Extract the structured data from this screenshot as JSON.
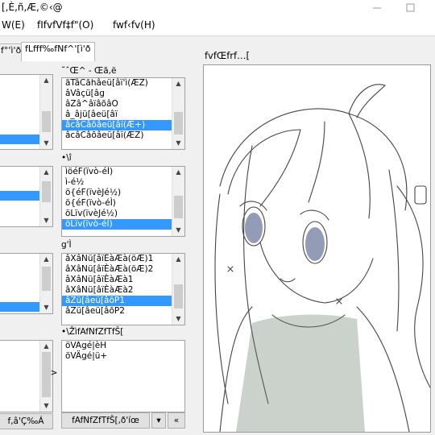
{
  "window": {
    "title": "[,È,ñ,Æ,©‹@"
  },
  "menu": {
    "items": [
      "W(E)",
      "fIfvfVf‡f\"(O)",
      "fwf‹fv(H)"
    ]
  },
  "tabs": [
    "f°'ì'ð",
    "fLfff‰fNf^'[ì'ð"
  ],
  "groups": {
    "g1_label": "˜ˆŒ^ - Œã,ë",
    "g2_label": "•\\î",
    "g3_label": "g'Ì",
    "g4_label": "•\\ŽìfAfNfZfTfŠ["
  },
  "list1": [
    "ãTâCãhâeü[âï'ì(ÆZ)",
    "âVâçü[âg",
    "âZâ^âïâõâO",
    "â_âjü[âeü[âï",
    "âcâCâõâeü[âï(Æ+)",
    "âcâCâõâeü[âï(ÆZ)"
  ],
  "list2": [
    "ìöéF(ïvò-éÌ)",
    "ì-é½",
    "ö{éF(ïvèJé½)",
    "ö{éF(ïvò-éÌ)",
    "öLïv(ïvèJé½)",
    "öLïv(ïvò-éÌ)"
  ],
  "list3": [
    "âXâNü[âïÈàÆà(öÆ)1",
    "âXâNü[âïÈàÆà(öÆ)2",
    "âXâNü[âïÈàÆà1",
    "âXâNü[âïÈàÆà2",
    "âZü[âeü[âõP1",
    "âZü[âeü[âõP2"
  ],
  "list4": [
    "öVÄgé|èH",
    "öVÄgé|ü+"
  ],
  "buttons": {
    "arrow_right": ">",
    "left_bottom": "f,â'Ç‰Á",
    "random": "fAfNfZfTfŠ[,ð'íœ",
    "sort": "▾",
    "back": "«"
  },
  "preview": {
    "label": "fvfŒfrf…["
  },
  "colors": {
    "selection": "#3399ff",
    "window_bg": "#f0f0f0"
  }
}
